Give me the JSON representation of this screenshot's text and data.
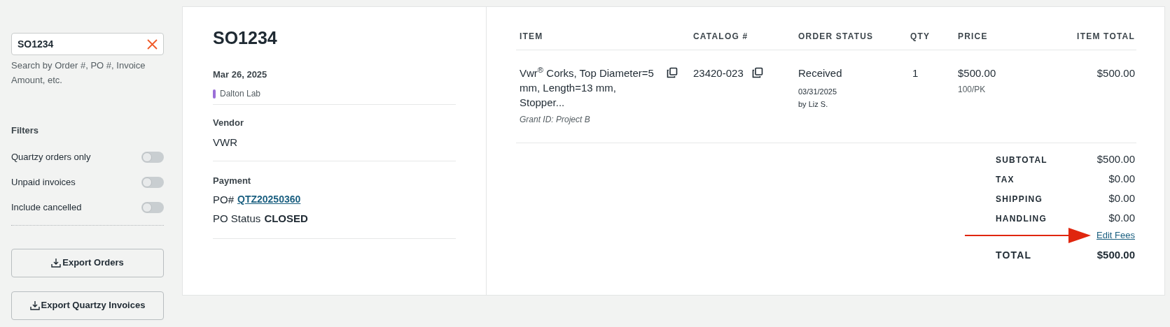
{
  "search": {
    "value": "SO1234",
    "hint": "Search by Order #, PO #, Invoice Amount, etc."
  },
  "filters": {
    "title": "Filters",
    "items": [
      {
        "label": "Quartzy orders only",
        "on": false
      },
      {
        "label": "Unpaid invoices",
        "on": false
      },
      {
        "label": "Include cancelled",
        "on": false
      }
    ]
  },
  "buttons": [
    "Export Orders",
    "Export Quartzy Invoices"
  ],
  "order": {
    "number": "SO1234",
    "date": "Mar 26, 2025",
    "lab": {
      "name": "Dalton Lab",
      "color": "#9b6fd8"
    },
    "vendor_label": "Vendor",
    "vendor": "VWR",
    "payment_label": "Payment",
    "po_prefix": "PO#",
    "po_number": "QTZ20250360",
    "po_status_label": "PO Status",
    "po_status": "CLOSED"
  },
  "table": {
    "columns": [
      "ITEM",
      "CATALOG #",
      "ORDER STATUS",
      "QTY",
      "PRICE",
      "ITEM TOTAL"
    ],
    "rows": [
      {
        "item": "Vwr$^{®}$ Corks, Top Diameter=5 mm, Length=13 mm, Stopper...",
        "grant": "Grant ID: Project B",
        "catalog": "23420-023",
        "status": "Received",
        "status_date": "03/31/2025",
        "status_by": "by Liz S.",
        "qty": "1",
        "price": "$500.00",
        "unit": "100/PK",
        "total": "$500.00"
      }
    ]
  },
  "summary": [
    {
      "label": "SUBTOTAL",
      "value": "$500.00"
    },
    {
      "label": "TAX",
      "value": "$0.00"
    },
    {
      "label": "SHIPPING",
      "value": "$0.00"
    },
    {
      "label": "HANDLING",
      "value": "$0.00"
    }
  ],
  "edit_fees": "Edit Fees",
  "total": {
    "label": "TOTAL",
    "value": "$500.00"
  }
}
